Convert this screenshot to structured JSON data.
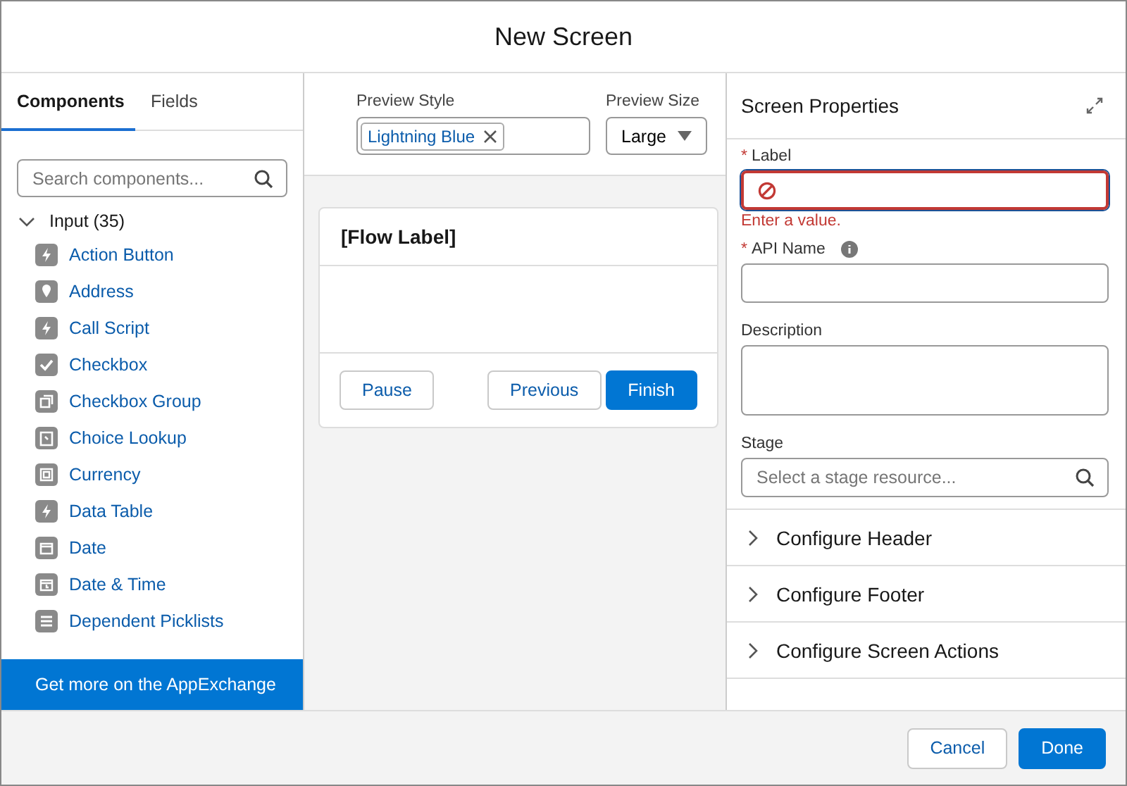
{
  "window": {
    "title": "New Screen"
  },
  "tabs": [
    {
      "label": "Components",
      "selected": true
    },
    {
      "label": "Fields",
      "selected": false
    }
  ],
  "search": {
    "placeholder": "Search components..."
  },
  "group": {
    "label": "Input (35)",
    "expanded": true,
    "items": [
      "Action Button",
      "Address",
      "Call Script",
      "Checkbox",
      "Checkbox Group",
      "Choice Lookup",
      "Currency",
      "Data Table",
      "Date",
      "Date & Time",
      "Dependent Picklists"
    ]
  },
  "appexchange": "Get more on the AppExchange",
  "preview": {
    "style_label": "Preview Style",
    "style_pill": "Lightning Blue",
    "size_label": "Preview Size",
    "size_value": "Large"
  },
  "canvas": {
    "title": "[Flow Label]",
    "buttons": [
      {
        "label": "Pause",
        "kind": "neutral"
      },
      {
        "label": "Previous",
        "kind": "neutral"
      },
      {
        "label": "Finish",
        "kind": "brand"
      }
    ]
  },
  "properties": {
    "title": "Screen Properties",
    "fields": [
      {
        "label": "Label",
        "required_mark": "*",
        "kind": "input",
        "error": "Enter a value.",
        "info": false
      },
      {
        "label": "API Name",
        "required_mark": "*",
        "kind": "input",
        "info": true
      },
      {
        "label": "Description",
        "kind": "textarea",
        "info": false
      },
      {
        "label": "Stage",
        "kind": "search",
        "placeholder": "Select a stage resource...",
        "info": false
      }
    ],
    "sections": [
      {
        "label": "Configure Header",
        "expanded": false
      },
      {
        "label": "Configure Footer",
        "expanded": false
      },
      {
        "label": "Configure Screen Actions",
        "expanded": false
      }
    ]
  },
  "footer": {
    "buttons": [
      {
        "label": "Cancel",
        "kind": "neutral"
      },
      {
        "label": "Done",
        "kind": "brand"
      }
    ]
  }
}
